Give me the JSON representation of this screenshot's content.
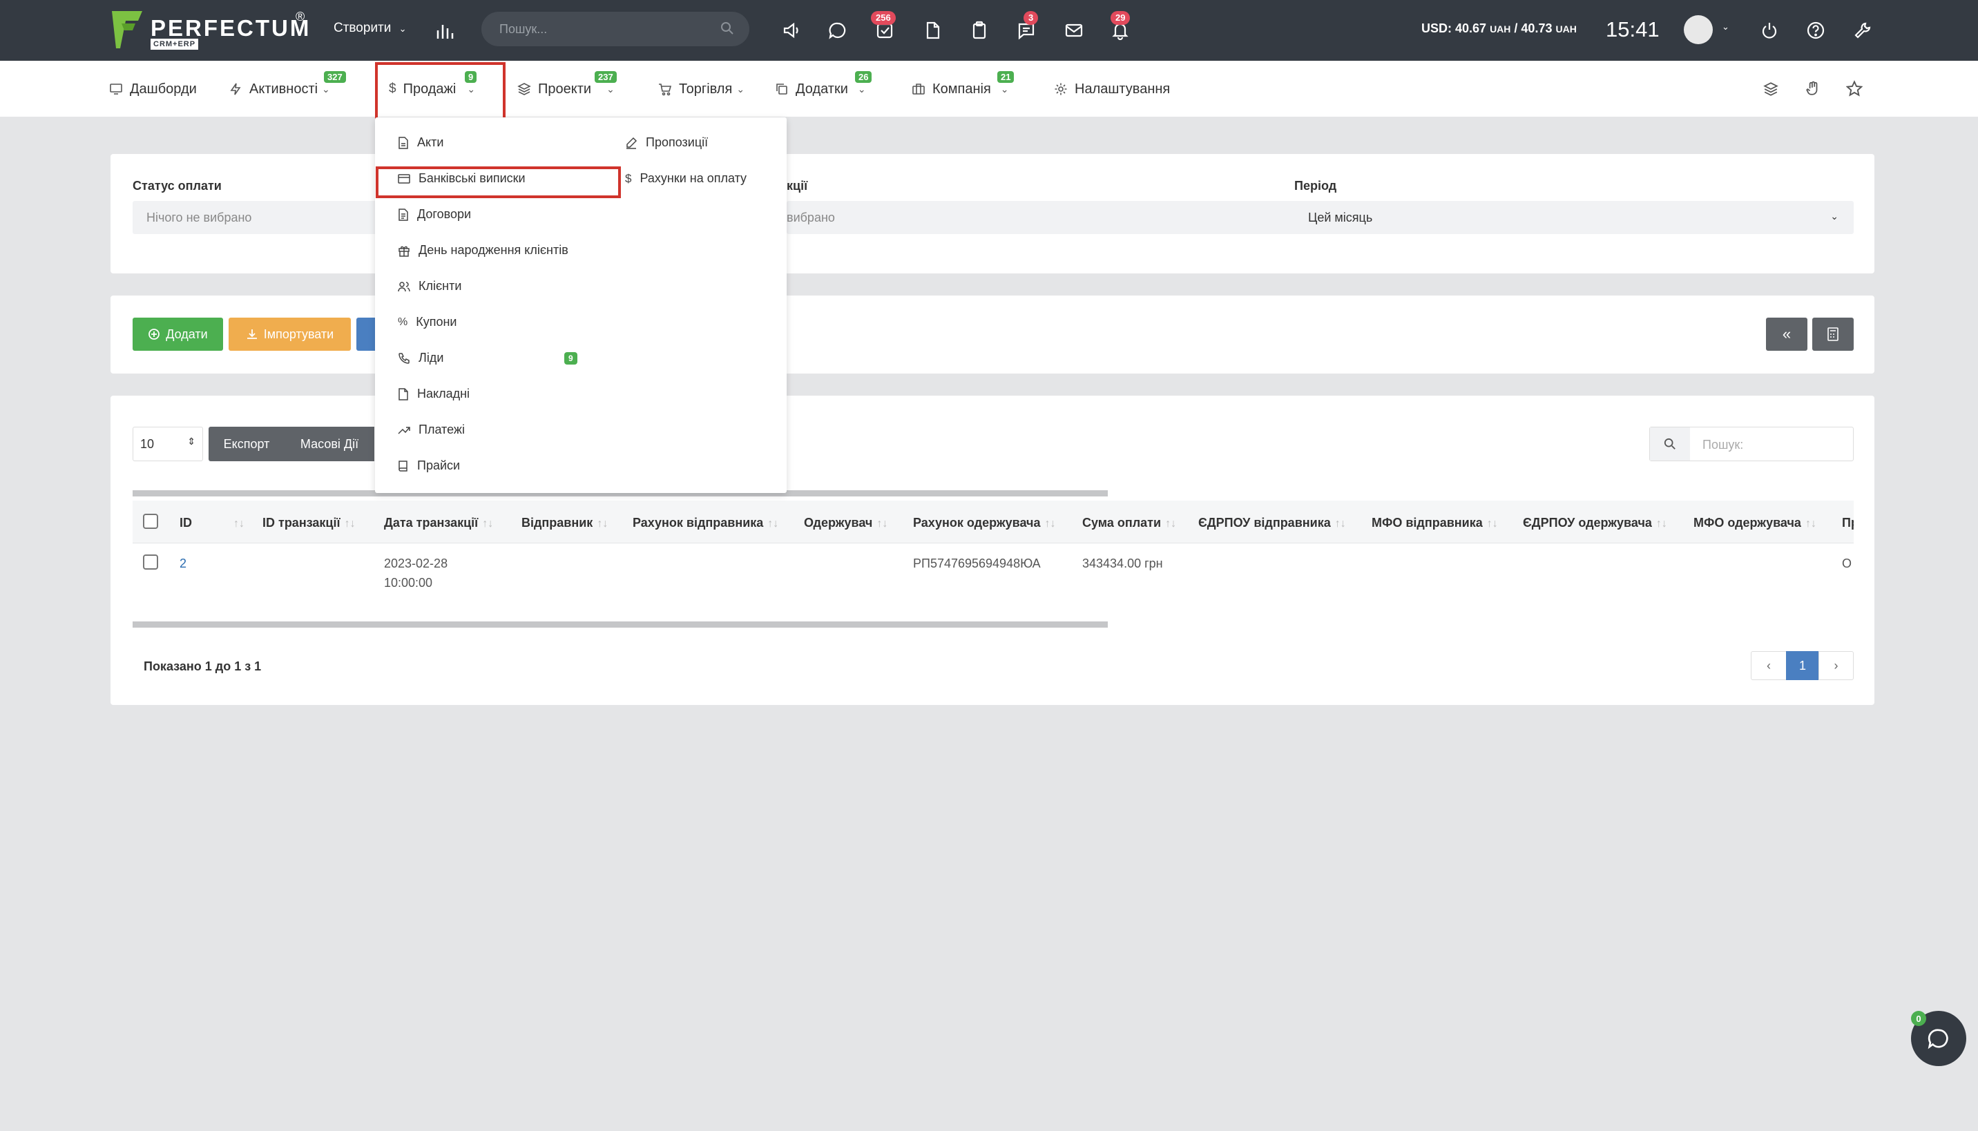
{
  "header": {
    "logo_name": "PERFECTUM",
    "logo_reg": "®",
    "logo_sub": "CRM+ERP",
    "create_label": "Створити",
    "search_placeholder": "Пошук...",
    "badges": {
      "tasks": "256",
      "chat": "3",
      "notifications": "29"
    },
    "rate_text": "USD: 40.67",
    "rate_unit1": "UAH",
    "rate_sep": "/ 40.73",
    "rate_unit2": "UAH",
    "time": "15:41"
  },
  "nav": {
    "dashboards": "Дашборди",
    "activities": "Активності",
    "activities_badge": "327",
    "sales": "Продажі",
    "sales_badge": "9",
    "projects": "Проекти",
    "projects_badge": "237",
    "trade": "Торгівля",
    "addons": "Додатки",
    "addons_badge": "26",
    "company": "Компанія",
    "company_badge": "21",
    "settings": "Налаштування"
  },
  "sales_menu": {
    "left": [
      "Акти",
      "Банківські виписки",
      "Договори",
      "День народження клієнтів",
      "Клієнти",
      "Купони",
      "Ліди",
      "Накладні",
      "Платежі",
      "Прайси"
    ],
    "leads_badge": "9",
    "right": [
      "Пропозиції",
      "Рахунки на оплату"
    ]
  },
  "filters": {
    "payment_status_label": "Статус оплати",
    "payment_status_value": "Нічого не вибрано",
    "transaction_label_visible": "кції",
    "transaction_value_visible": "вибрано",
    "period_label": "Період",
    "period_value": "Цей місяць"
  },
  "actions": {
    "add": "Додати",
    "import": "Імпортувати",
    "collapse": "«"
  },
  "table_controls": {
    "page_size": "10",
    "export": "Експорт",
    "bulk": "Масові Дії",
    "search_placeholder": "Пошук:"
  },
  "table": {
    "columns": [
      "ID",
      "ID транзакції",
      "Дата транзакції",
      "Відправник",
      "Рахунок відправника",
      "Одержувач",
      "Рахунок одержувача",
      "Сума оплати",
      "ЄДРПОУ відправника",
      "МФО відправника",
      "ЄДРПОУ одержувача",
      "МФО одержувача",
      "Пр"
    ],
    "rows": [
      {
        "id": "2",
        "date_line1": "2023-02-28",
        "date_line2": "10:00:00",
        "recipient_account": "РП5747695694948ЮА",
        "amount": "343434.00 грн",
        "tail": "О"
      }
    ]
  },
  "footer": {
    "info": "Показано 1 до 1 з 1",
    "prev": "‹",
    "page": "1",
    "next": "›"
  },
  "chat": {
    "badge": "0"
  },
  "colors": {
    "topbar": "#343a42",
    "green": "#4caf50",
    "orange": "#f0ad4e",
    "blue": "#4a7fc1",
    "highlight": "#d0342c",
    "badge_red": "#e24a5c"
  }
}
